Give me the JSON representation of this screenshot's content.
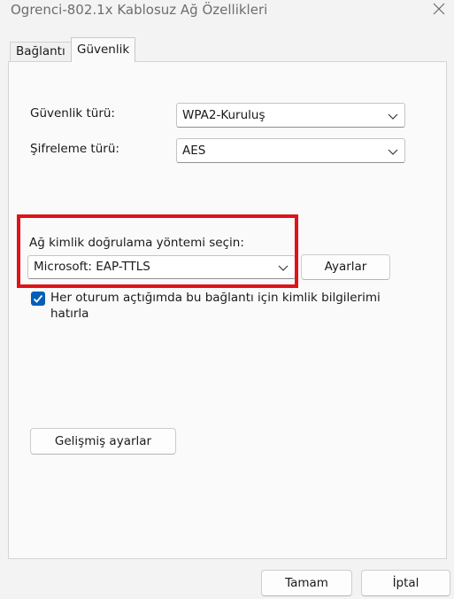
{
  "window": {
    "title": "Ogrenci-802.1x Kablosuz Ağ Özellikleri",
    "close_icon": "close-icon"
  },
  "tabs": [
    {
      "label": "Bağlantı",
      "active": false
    },
    {
      "label": "Güvenlik",
      "active": true
    }
  ],
  "security": {
    "type_label": "Güvenlik türü:",
    "type_value": "WPA2-Kuruluş",
    "encryption_label": "Şifreleme türü:",
    "encryption_value": "AES"
  },
  "auth": {
    "method_label": "Ağ kimlik doğrulama yöntemi seçin:",
    "method_value": "Microsoft: EAP-TTLS",
    "settings_button": "Ayarlar",
    "remember_checked": true,
    "remember_line1": "Her oturum açtığımda bu bağlantı için kimlik bilgilerimi",
    "remember_line2": "hatırla"
  },
  "advanced_button": "Gelişmiş ayarlar",
  "footer": {
    "ok_button": "Tamam",
    "cancel_button": "İptal"
  },
  "colors": {
    "highlight": "#e0121a",
    "checkbox_accent": "#005fb8"
  }
}
